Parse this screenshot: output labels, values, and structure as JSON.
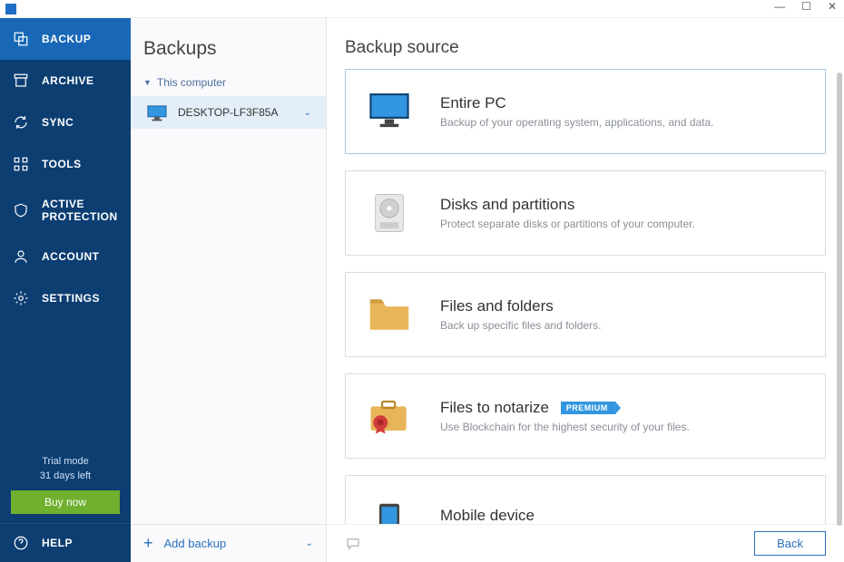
{
  "titlebar": {
    "title": ""
  },
  "sidebar": {
    "items": [
      {
        "label": "BACKUP"
      },
      {
        "label": "ARCHIVE"
      },
      {
        "label": "SYNC"
      },
      {
        "label": "TOOLS"
      },
      {
        "label": "ACTIVE PROTECTION"
      },
      {
        "label": "ACCOUNT"
      },
      {
        "label": "SETTINGS"
      }
    ],
    "trial_line1": "Trial mode",
    "trial_line2": "31 days left",
    "buy_label": "Buy now",
    "help_label": "HELP"
  },
  "listcol": {
    "title": "Backups",
    "group_label": "This computer",
    "entry_label": "DESKTOP-LF3F85A",
    "add_label": "Add backup"
  },
  "main": {
    "title": "Backup source",
    "options": [
      {
        "heading": "Entire PC",
        "desc": "Backup of your operating system, applications, and data."
      },
      {
        "heading": "Disks and partitions",
        "desc": "Protect separate disks or partitions of your computer."
      },
      {
        "heading": "Files and folders",
        "desc": "Back up specific files and folders."
      },
      {
        "heading": "Files to notarize",
        "desc": "Use Blockchain for the highest security of your files.",
        "badge": "PREMIUM"
      },
      {
        "heading": "Mobile device",
        "desc": ""
      }
    ],
    "back_label": "Back"
  }
}
